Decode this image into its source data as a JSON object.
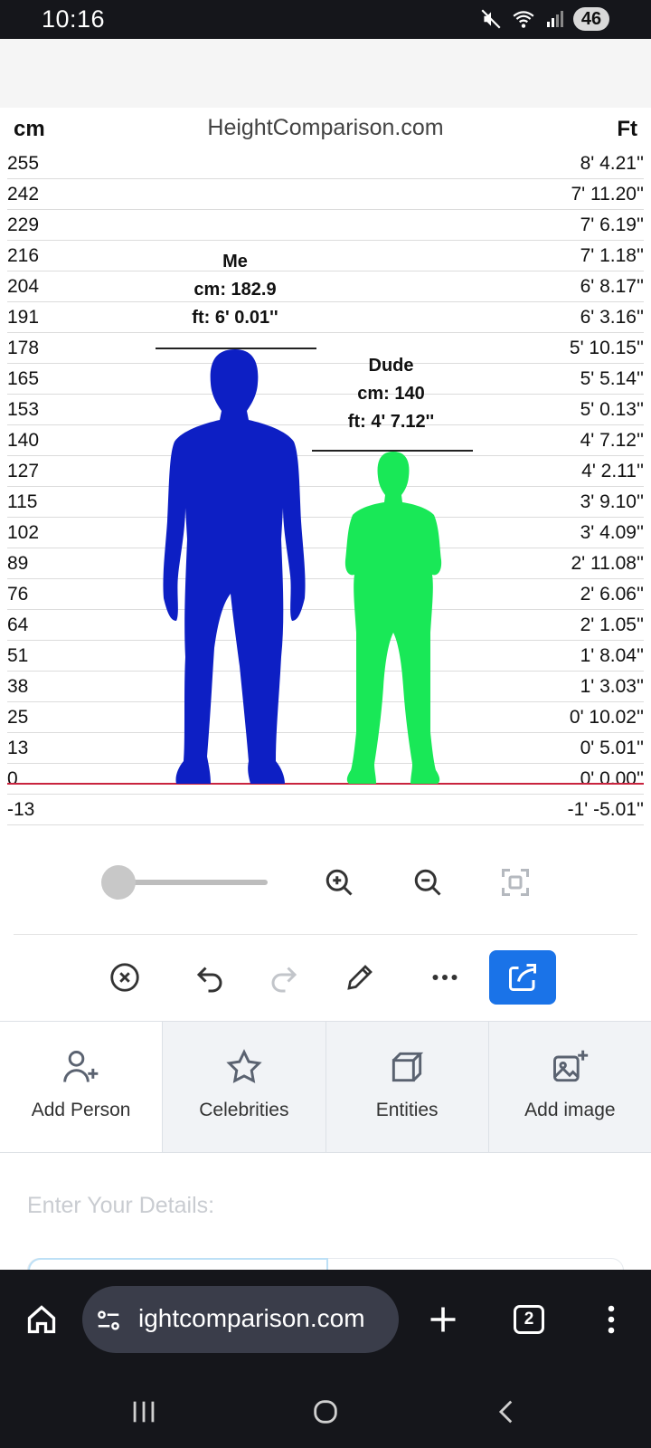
{
  "status_bar": {
    "time": "10:16",
    "battery": "46"
  },
  "chart": {
    "cm_header": "cm",
    "ft_header": "Ft",
    "site_title": "HeightComparison.com",
    "rows": [
      {
        "cm": "255",
        "ft": "8' 4.21''"
      },
      {
        "cm": "242",
        "ft": "7' 11.20''"
      },
      {
        "cm": "229",
        "ft": "7' 6.19''"
      },
      {
        "cm": "216",
        "ft": "7' 1.18''"
      },
      {
        "cm": "204",
        "ft": "6' 8.17''"
      },
      {
        "cm": "191",
        "ft": "6' 3.16''"
      },
      {
        "cm": "178",
        "ft": "5' 10.15''"
      },
      {
        "cm": "165",
        "ft": "5' 5.14''"
      },
      {
        "cm": "153",
        "ft": "5' 0.13''"
      },
      {
        "cm": "140",
        "ft": "4' 7.12''"
      },
      {
        "cm": "127",
        "ft": "4' 2.11''"
      },
      {
        "cm": "115",
        "ft": "3' 9.10''"
      },
      {
        "cm": "102",
        "ft": "3' 4.09''"
      },
      {
        "cm": "89",
        "ft": "2' 11.08''"
      },
      {
        "cm": "76",
        "ft": "2' 6.06''"
      },
      {
        "cm": "64",
        "ft": "2' 1.05''"
      },
      {
        "cm": "51",
        "ft": "1' 8.04''"
      },
      {
        "cm": "38",
        "ft": "1' 3.03''"
      },
      {
        "cm": "25",
        "ft": "0' 10.02''"
      },
      {
        "cm": "13",
        "ft": "0' 5.01''"
      },
      {
        "cm": "0",
        "ft": "0' 0.00''"
      },
      {
        "cm": "-13",
        "ft": "-1' -5.01''"
      }
    ],
    "people": [
      {
        "name": "Me",
        "cm_label": "cm: 182.9",
        "ft_label": "ft: 6' 0.01''",
        "height_cm": 182.9,
        "color": "#0d1fc4"
      },
      {
        "name": "Dude",
        "cm_label": "cm: 140",
        "ft_label": "ft: 4' 7.12''",
        "height_cm": 140,
        "color": "#19e857"
      }
    ]
  },
  "zoom": {
    "slider_value": 0
  },
  "tabs": [
    {
      "label": "Add Person",
      "icon": "add-person-icon"
    },
    {
      "label": "Celebrities",
      "icon": "star-icon"
    },
    {
      "label": "Entities",
      "icon": "cube-icon"
    },
    {
      "label": "Add image",
      "icon": "add-image-icon"
    }
  ],
  "details": {
    "title": "Enter Your Details:"
  },
  "browser": {
    "url": "ightcomparison.com",
    "tab_count": "2"
  }
}
